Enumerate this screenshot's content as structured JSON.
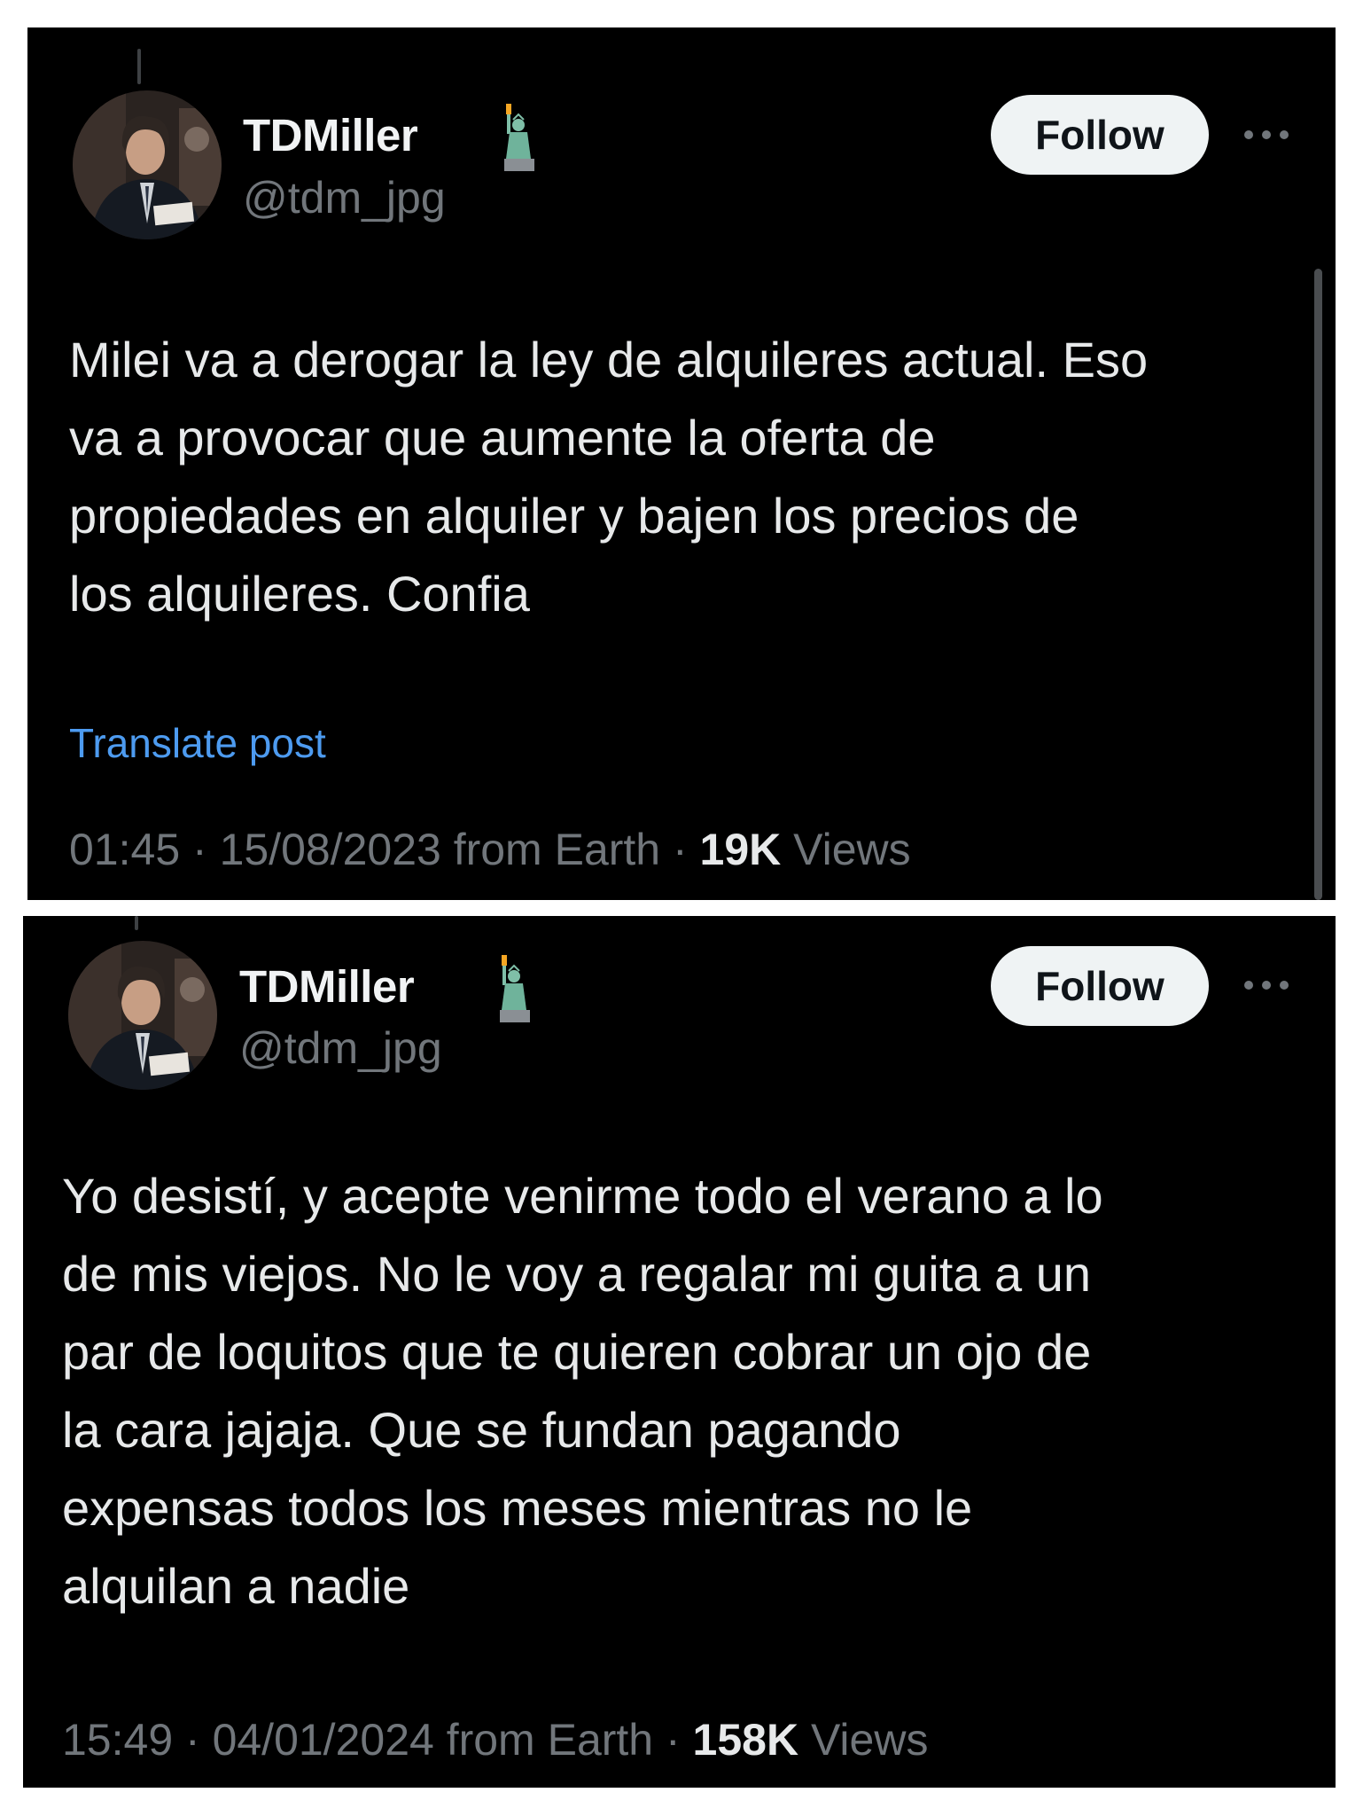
{
  "posts": [
    {
      "author": {
        "name": "TDMiller",
        "handle": "@tdm_jpg",
        "badge_icon": "statue-of-liberty-icon"
      },
      "follow_label": "Follow",
      "more_icon": "more-dots-icon",
      "text": "Milei va a derogar la ley de alquileres actual. Eso\nva a provocar que aumente la oferta de\npropiedades en alquiler y bajen los precios de\nlos alquileres. Confia",
      "translate_label": "Translate post",
      "time": "01:45",
      "sep1": " · ",
      "date": "15/08/2023",
      "location": " from Earth",
      "sep2": " · ",
      "views_count": "19K",
      "views_label": " Views"
    },
    {
      "author": {
        "name": "TDMiller",
        "handle": "@tdm_jpg",
        "badge_icon": "statue-of-liberty-icon"
      },
      "follow_label": "Follow",
      "more_icon": "more-dots-icon",
      "text": "Yo desistí, y acepte venirme todo el verano a lo\nde mis viejos. No le voy a regalar mi guita a un\npar de loquitos que te quieren cobrar un ojo de\nla cara jajaja. Que se fundan pagando\nexpensas todos los meses mientras no le\nalquilan a nadie",
      "time": "15:49",
      "sep1": " · ",
      "date": "04/01/2024",
      "location": " from Earth",
      "sep2": " · ",
      "views_count": "158K",
      "views_label": " Views"
    }
  ],
  "colors": {
    "background": "#000000",
    "primary_text": "#e7e9ea",
    "secondary_text": "#71767b",
    "link": "#4d9bf0",
    "follow_button_bg": "#eff3f4"
  }
}
